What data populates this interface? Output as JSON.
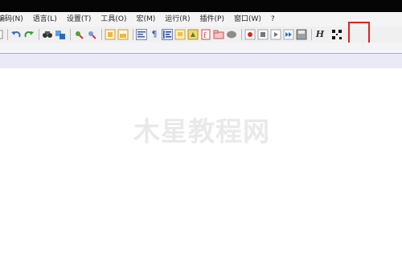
{
  "menu": {
    "items": [
      {
        "label": "编码(N)"
      },
      {
        "label": "语言(L)"
      },
      {
        "label": "设置(T)"
      },
      {
        "label": "工具(O)"
      },
      {
        "label": "宏(M)"
      },
      {
        "label": "运行(R)"
      },
      {
        "label": "插件(P)"
      },
      {
        "label": "窗口(W)"
      },
      {
        "label": "?"
      }
    ]
  },
  "toolbar": {
    "word_wrap_glyph": "¶",
    "h_label": "H",
    "highlighted_icon": "qr-code-icon",
    "highlight_color": "#e52020"
  },
  "watermark": {
    "text": "木星教程网"
  }
}
